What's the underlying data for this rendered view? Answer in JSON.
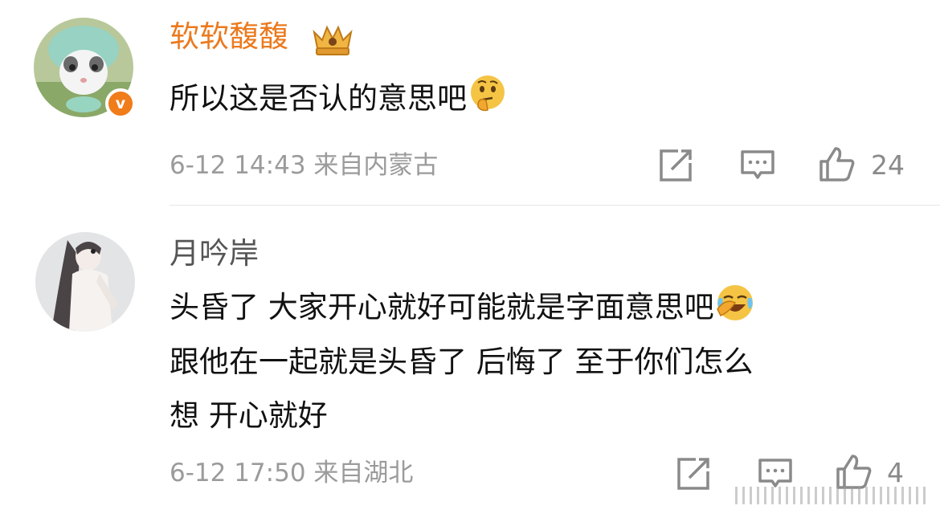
{
  "comments": [
    {
      "username": "软软馥馥",
      "badge_letter": "v",
      "crown_icon": "vip-crown-icon",
      "text": "所以这是否认的意思吧",
      "emoji": "thinking-face-emoji",
      "meta": "6-12 14:43 来自内蒙古",
      "like_count": "24"
    },
    {
      "username": "月吟岸",
      "text_lines": [
        "头昏了 大家开心就好可能就是字面意思吧",
        "跟他在一起就是头昏了 后悔了 至于你们怎么",
        "想 开心就好"
      ],
      "emoji": "laughing-crying-emoji",
      "meta": "6-12 17:50 来自湖北",
      "like_count": "4"
    }
  ],
  "colors": {
    "username_highlight": "#eb7a1e",
    "verified_badge": "#f07c1a",
    "meta_gray": "#9b9b9b"
  }
}
